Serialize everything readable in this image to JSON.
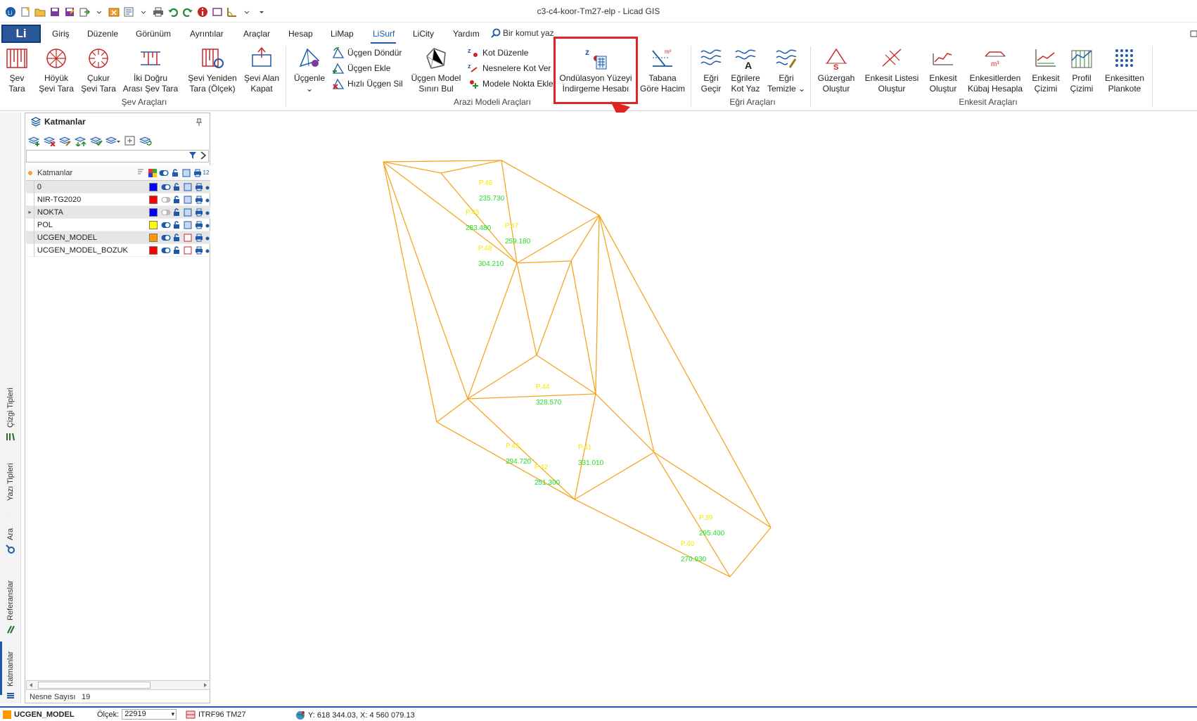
{
  "window": {
    "title": "c3-c4-koor-Tm27-elp  - Licad GIS"
  },
  "menu": {
    "app_button": "Li",
    "tabs": [
      "Giriş",
      "Düzenle",
      "Görünüm",
      "Ayrıntılar",
      "Araçlar",
      "Hesap",
      "LiMap",
      "LiSurf",
      "LiCity",
      "Yardım"
    ],
    "active_tab": "LiSurf",
    "search_placeholder": "Bir komut yaz"
  },
  "ribbon": {
    "sev": {
      "label": "Şev Araçları",
      "buttons": [
        {
          "l1": "Şev",
          "l2": "Tara"
        },
        {
          "l1": "Höyük",
          "l2": "Şevi Tara"
        },
        {
          "l1": "Çukur",
          "l2": "Şevi Tara"
        },
        {
          "l1": "İki Doğru",
          "l2": "Arası Şev Tara"
        },
        {
          "l1": "Şevi Yeniden",
          "l2": "Tara (Ölçek)"
        },
        {
          "l1": "Şevi Alan",
          "l2": "Kapat"
        }
      ]
    },
    "arazi": {
      "label": "Arazi Modeli Araçları",
      "ucgenle": "Üçgenle",
      "small_a": [
        "Üçgen Döndür",
        "Üçgen Ekle",
        "Hızlı Üçgen Sil"
      ],
      "sinir": {
        "l1": "Üçgen Model",
        "l2": "Sınırı Bul"
      },
      "small_b": [
        "Kot Düzenle",
        "Nesnelere Kot Ver",
        "Modele Nokta Ekle"
      ],
      "ondulasyon": {
        "l1": "Ondülasyon Yüzeyi",
        "l2": "İndirgeme Hesabı"
      },
      "tabana": {
        "l1": "Tabana",
        "l2": "Göre Hacim"
      }
    },
    "egri": {
      "label": "Eğri Araçları",
      "buttons": [
        {
          "l1": "Eğri",
          "l2": "Geçir"
        },
        {
          "l1": "Eğrilere",
          "l2": "Kot Yaz"
        },
        {
          "l1": "Eğri",
          "l2": "Temizle"
        }
      ]
    },
    "enkesit": {
      "label": "Enkesit Araçları",
      "buttons": [
        {
          "l1": "Güzergah",
          "l2": "Oluştur"
        },
        {
          "l1": "Enkesit Listesi",
          "l2": "Oluştur"
        },
        {
          "l1": "Enkesit",
          "l2": "Oluştur"
        },
        {
          "l1": "Enkesitlerden",
          "l2": "Kübaj Hesapla"
        },
        {
          "l1": "Enkesit",
          "l2": "Çizimi"
        },
        {
          "l1": "Profil",
          "l2": "Çizimi"
        },
        {
          "l1": "Enkesitten",
          "l2": "Plankote"
        }
      ]
    }
  },
  "side_tabs": [
    "Çizgi Tipleri",
    "Yazı Tipleri",
    "Ara",
    "Referanslar",
    "Katmanlar"
  ],
  "layers_panel": {
    "title": "Katmanlar",
    "column_header": "Katmanlar",
    "rows": [
      {
        "name": "0",
        "color": "#0000ff",
        "selected": true
      },
      {
        "name": "NIR-TG2020",
        "color": "#ff0000",
        "selected": false
      },
      {
        "name": "NOKTA",
        "color": "#0000ff",
        "selected": true
      },
      {
        "name": "POL",
        "color": "#ffff00",
        "selected": false
      },
      {
        "name": "UCGEN_MODEL",
        "color": "#ff9900",
        "selected": true
      },
      {
        "name": "UCGEN_MODEL_BOZUK",
        "color": "#ff0000",
        "selected": false
      }
    ],
    "object_count_label": "Nesne Sayısı",
    "object_count": "19"
  },
  "map": {
    "points": [
      {
        "id": "P.46",
        "z": "235.730"
      },
      {
        "id": "P.45",
        "z": "283.480"
      },
      {
        "id": "P.47",
        "z": "259.180"
      },
      {
        "id": "P.48",
        "z": "304.210"
      },
      {
        "id": "P.44",
        "z": "328.570"
      },
      {
        "id": "P.43",
        "z": "294.720"
      },
      {
        "id": "P.41",
        "z": "331.010"
      },
      {
        "id": "P.42",
        "z": "251.300"
      },
      {
        "id": "P.39",
        "z": "295.400"
      },
      {
        "id": "P.40",
        "z": "270.930"
      }
    ]
  },
  "status": {
    "layer": "UCGEN_MODEL",
    "scale_label": "Ölçek:",
    "scale_value": "22919",
    "crs": "ITRF96 TM27",
    "coords": "Y: 618 344.03, X: 4 560 079.13"
  }
}
